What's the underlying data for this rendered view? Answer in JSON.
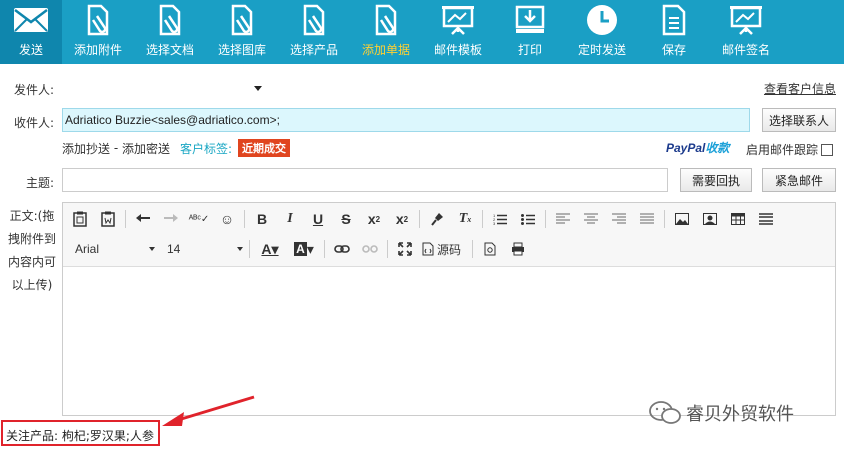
{
  "toolbar": {
    "items": [
      {
        "label": "发送",
        "icon": "envelope-icon"
      },
      {
        "label": "添加附件",
        "icon": "attachment-doc-icon"
      },
      {
        "label": "选择文档",
        "icon": "document-clip-icon"
      },
      {
        "label": "选择图库",
        "icon": "gallery-clip-icon"
      },
      {
        "label": "选择产品",
        "icon": "product-clip-icon"
      },
      {
        "label": "添加单据",
        "icon": "invoice-clip-icon"
      },
      {
        "label": "邮件模板",
        "icon": "template-board-icon"
      },
      {
        "label": "打印",
        "icon": "print-icon"
      },
      {
        "label": "定时发送",
        "icon": "clock-icon"
      },
      {
        "label": "保存",
        "icon": "save-doc-icon"
      },
      {
        "label": "邮件签名",
        "icon": "signature-board-icon"
      }
    ],
    "highlight_color": "#ffd033",
    "background": "#1a9fc5"
  },
  "form": {
    "sender_label": "发件人:",
    "view_customer_link": "查看客户信息",
    "to_label": "收件人:",
    "to_value": "Adriatico Buzzie<sales@adriatico.com>;",
    "select_contact_button": "选择联系人",
    "add_cc": "添加抄送",
    "separator": " - ",
    "add_bcc": "添加密送",
    "customer_tag_label": "客户标签:",
    "customer_tag_badge": "近期成交",
    "paypal_part1": "PayPal",
    "paypal_part2": "收款",
    "enable_tracking": "启用邮件跟踪",
    "subject_label": "主题:",
    "receipt_button": "需要回执",
    "urgent_button": "紧急邮件",
    "body_label": "正文:(拖拽附件到内容内可以上传)"
  },
  "editor": {
    "font_family": "Arial",
    "font_size": "14",
    "source_label": "源码",
    "row1_icons": [
      "paste-icon",
      "paste-word-icon",
      "undo-icon",
      "redo-icon",
      "spellcheck-icon",
      "emoji-icon",
      "bold-icon",
      "italic-icon",
      "underline-icon",
      "strikethrough-icon",
      "subscript-icon",
      "superscript-icon",
      "format-painter-icon",
      "clear-format-icon",
      "ordered-list-icon",
      "unordered-list-icon",
      "align-left-icon",
      "align-center-icon",
      "align-right-icon",
      "align-justify-icon",
      "image-icon",
      "image-edit-icon",
      "table-icon",
      "horizontal-rule-icon"
    ],
    "row2_icons": [
      "font-color-icon",
      "background-color-icon",
      "link-icon",
      "unlink-icon",
      "fullscreen-icon",
      "source-code-icon",
      "preview-icon",
      "print-icon"
    ]
  },
  "footer": {
    "focus_products": "关注产品: 枸杞;罗汉果;人参",
    "watermark": "睿贝外贸软件",
    "annotation_color": "#e0232b"
  }
}
